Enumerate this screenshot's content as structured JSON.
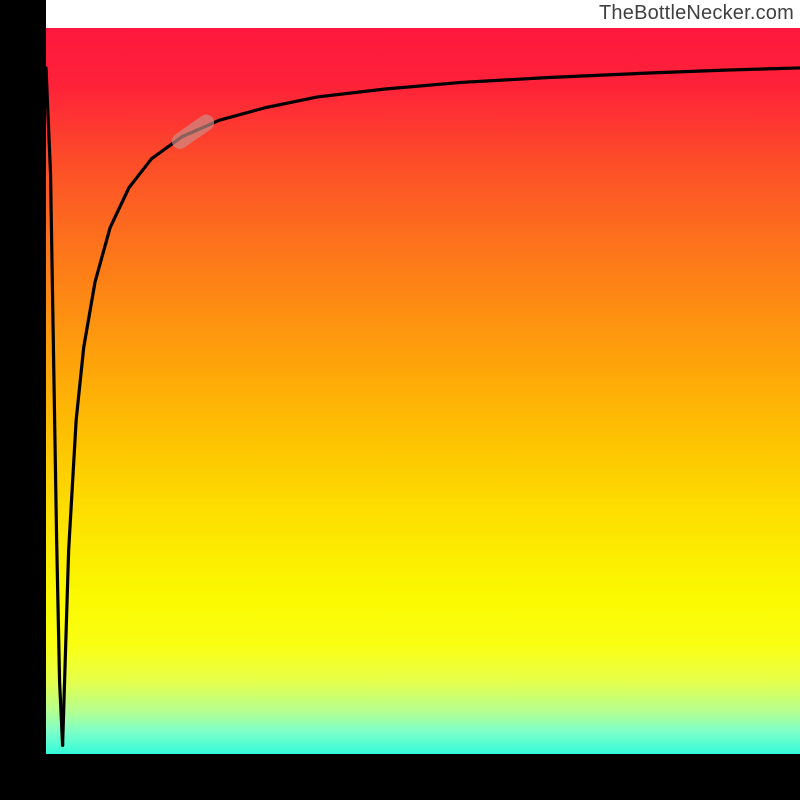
{
  "attribution": "TheBottleNecker.com",
  "gradient": {
    "stops": [
      {
        "offset": 0.0,
        "color": "#fe183e"
      },
      {
        "offset": 0.08,
        "color": "#fe2239"
      },
      {
        "offset": 0.18,
        "color": "#fd4b29"
      },
      {
        "offset": 0.28,
        "color": "#fd6d1e"
      },
      {
        "offset": 0.38,
        "color": "#fd8b13"
      },
      {
        "offset": 0.48,
        "color": "#fea908"
      },
      {
        "offset": 0.58,
        "color": "#fdc600"
      },
      {
        "offset": 0.68,
        "color": "#fde200"
      },
      {
        "offset": 0.78,
        "color": "#fbf900"
      },
      {
        "offset": 0.85,
        "color": "#faff12"
      },
      {
        "offset": 0.9,
        "color": "#e5ff4b"
      },
      {
        "offset": 0.94,
        "color": "#b6ff8f"
      },
      {
        "offset": 0.97,
        "color": "#7bffca"
      },
      {
        "offset": 1.0,
        "color": "#34fbd9"
      }
    ]
  },
  "chart_data": {
    "type": "line",
    "title": "",
    "xlabel": "",
    "ylabel": "",
    "xlim": [
      0,
      100
    ],
    "ylim": [
      0,
      100
    ],
    "grid": false,
    "series": [
      {
        "name": "left-edge-drop",
        "x": [
          0.0,
          0.6,
          1.0,
          1.4,
          1.8,
          2.2
        ],
        "values": [
          94.5,
          80.0,
          55.0,
          30.0,
          10.0,
          1.2
        ]
      },
      {
        "name": "recovery-curve",
        "x": [
          2.2,
          3.0,
          4.0,
          5.0,
          6.5,
          8.5,
          11.0,
          14.0,
          18.0,
          23.0,
          29.0,
          36.0,
          45.0,
          55.0,
          67.0,
          80.0,
          90.0,
          100.0
        ],
        "values": [
          1.2,
          28.0,
          46.0,
          56.0,
          65.0,
          72.5,
          78.0,
          82.0,
          85.0,
          87.3,
          89.0,
          90.5,
          91.6,
          92.5,
          93.2,
          93.8,
          94.2,
          94.5
        ]
      }
    ],
    "annotations": [
      {
        "name": "marker-pill",
        "x": 19.5,
        "y": 85.7,
        "angle_deg": -35
      }
    ]
  }
}
